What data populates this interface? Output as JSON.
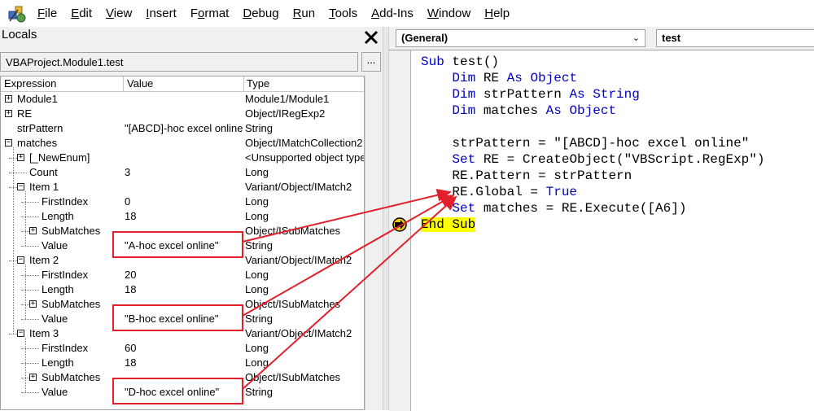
{
  "menu": {
    "items": [
      {
        "label": "File",
        "accel": "F"
      },
      {
        "label": "Edit",
        "accel": "E"
      },
      {
        "label": "View",
        "accel": "V"
      },
      {
        "label": "Insert",
        "accel": "I"
      },
      {
        "label": "Format",
        "accel": "o"
      },
      {
        "label": "Debug",
        "accel": "D"
      },
      {
        "label": "Run",
        "accel": "R"
      },
      {
        "label": "Tools",
        "accel": "T"
      },
      {
        "label": "Add-Ins",
        "accel": "A"
      },
      {
        "label": "Window",
        "accel": "W"
      },
      {
        "label": "Help",
        "accel": "H"
      }
    ]
  },
  "locals": {
    "title": "Locals",
    "context": "VBAProject.Module1.test",
    "context_button": "...",
    "headers": {
      "expression": "Expression",
      "value": "Value",
      "type": "Type"
    },
    "rows": [
      {
        "expr": "Module1",
        "value": "",
        "type": "Module1/Module1"
      },
      {
        "expr": "RE",
        "value": "",
        "type": "Object/IRegExp2"
      },
      {
        "expr": "strPattern",
        "value": "\"[ABCD]-hoc excel online\"",
        "type": "String"
      },
      {
        "expr": "matches",
        "value": "",
        "type": "Object/IMatchCollection2"
      },
      {
        "expr": "[_NewEnum]",
        "value": "",
        "type": "<Unsupported object type>"
      },
      {
        "expr": "Count",
        "value": "3",
        "type": "Long"
      },
      {
        "expr": "Item 1",
        "value": "",
        "type": "Variant/Object/IMatch2"
      },
      {
        "expr": "FirstIndex",
        "value": "0",
        "type": "Long"
      },
      {
        "expr": "Length",
        "value": "18",
        "type": "Long"
      },
      {
        "expr": "SubMatches",
        "value": "",
        "type": "Object/ISubMatches"
      },
      {
        "expr": "Value",
        "value": "\"A-hoc excel online\"",
        "type": "String"
      },
      {
        "expr": "Item 2",
        "value": "",
        "type": "Variant/Object/IMatch2"
      },
      {
        "expr": "FirstIndex",
        "value": "20",
        "type": "Long"
      },
      {
        "expr": "Length",
        "value": "18",
        "type": "Long"
      },
      {
        "expr": "SubMatches",
        "value": "",
        "type": "Object/ISubMatches"
      },
      {
        "expr": "Value",
        "value": "\"B-hoc excel online\"",
        "type": "String"
      },
      {
        "expr": "Item 3",
        "value": "",
        "type": "Variant/Object/IMatch2"
      },
      {
        "expr": "FirstIndex",
        "value": "60",
        "type": "Long"
      },
      {
        "expr": "Length",
        "value": "18",
        "type": "Long"
      },
      {
        "expr": "SubMatches",
        "value": "",
        "type": "Object/ISubMatches"
      },
      {
        "expr": "Value",
        "value": "\"D-hoc excel online\"",
        "type": "String"
      }
    ]
  },
  "code": {
    "object_combo": "(General)",
    "proc_combo": "test",
    "lines": [
      {
        "parts": [
          {
            "t": "Sub",
            "k": 1
          },
          {
            "t": " test()"
          }
        ]
      },
      {
        "parts": [
          {
            "t": "    "
          },
          {
            "t": "Dim",
            "k": 1
          },
          {
            "t": " RE "
          },
          {
            "t": "As",
            "k": 1
          },
          {
            "t": " "
          },
          {
            "t": "Object",
            "k": 1
          }
        ]
      },
      {
        "parts": [
          {
            "t": "    "
          },
          {
            "t": "Dim",
            "k": 1
          },
          {
            "t": " strPattern "
          },
          {
            "t": "As",
            "k": 1
          },
          {
            "t": " "
          },
          {
            "t": "String",
            "k": 1
          }
        ]
      },
      {
        "parts": [
          {
            "t": "    "
          },
          {
            "t": "Dim",
            "k": 1
          },
          {
            "t": " matches "
          },
          {
            "t": "As",
            "k": 1
          },
          {
            "t": " "
          },
          {
            "t": "Object",
            "k": 1
          }
        ]
      },
      {
        "parts": [
          {
            "t": ""
          }
        ]
      },
      {
        "parts": [
          {
            "t": "    strPattern = \"[ABCD]-hoc excel online\""
          }
        ]
      },
      {
        "parts": [
          {
            "t": "    "
          },
          {
            "t": "Set",
            "k": 1
          },
          {
            "t": " RE = CreateObject(\"VBScript.RegExp\")"
          }
        ]
      },
      {
        "parts": [
          {
            "t": "    RE.Pattern = strPattern"
          }
        ]
      },
      {
        "parts": [
          {
            "t": "    RE.Global = "
          },
          {
            "t": "True",
            "k": 1
          }
        ]
      },
      {
        "parts": [
          {
            "t": "    "
          },
          {
            "t": "Set",
            "k": 1
          },
          {
            "t": " matches = RE.Execute([A6])"
          }
        ]
      },
      {
        "parts": [
          {
            "t": "End Sub",
            "h": 1
          }
        ]
      }
    ]
  },
  "colors": {
    "keyword": "#0000c0",
    "highlight": "#ffff00",
    "annotation": "#e0202a"
  }
}
